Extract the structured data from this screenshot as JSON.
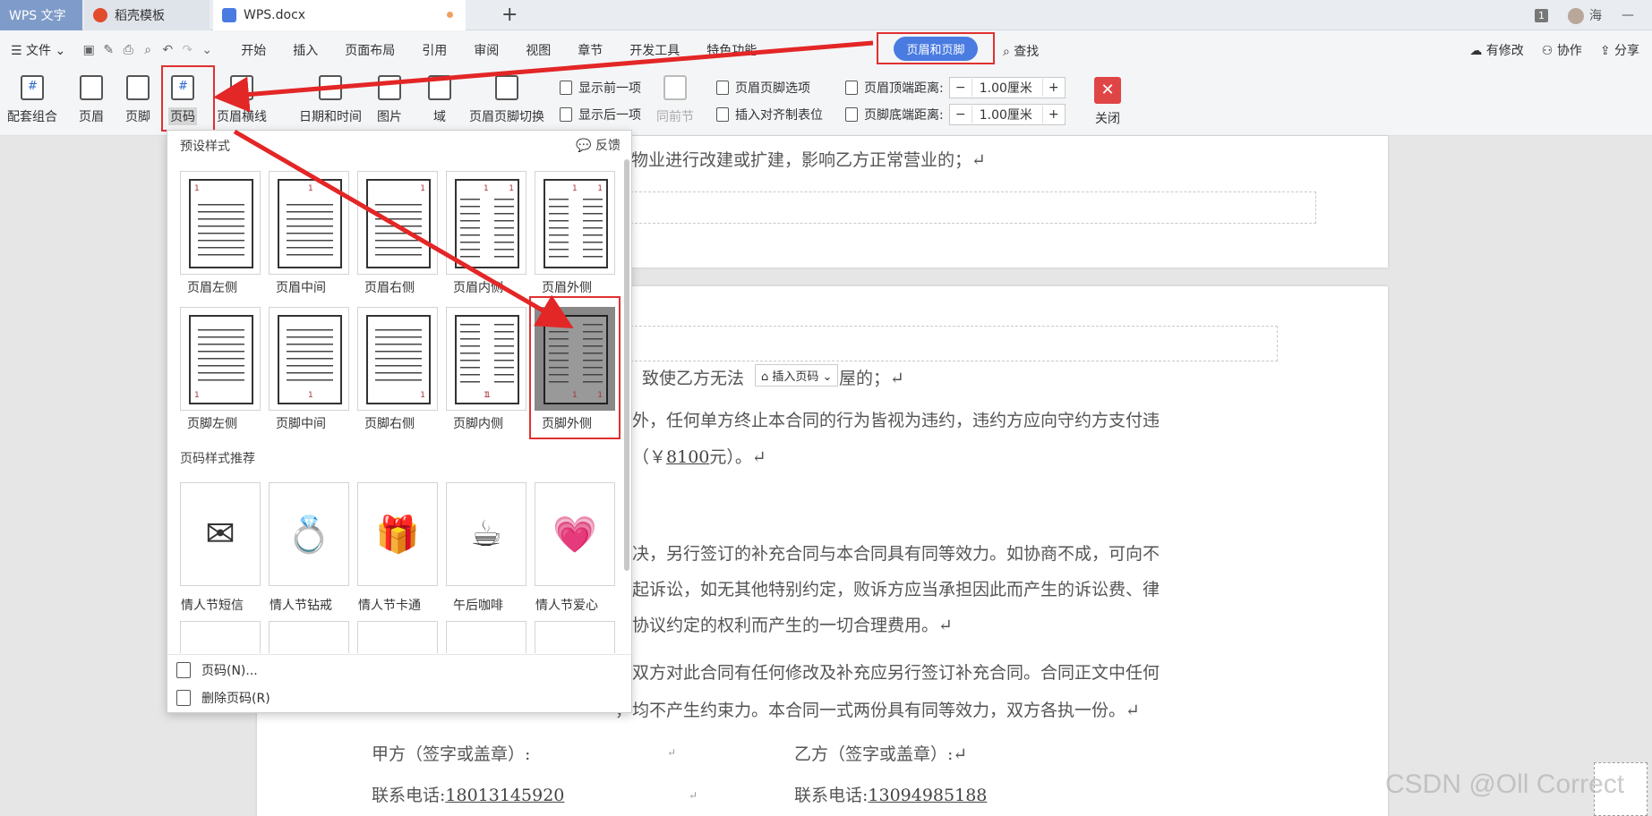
{
  "tabs": {
    "app": "WPS 文字",
    "daoke": "稻壳模板",
    "doc": "WPS.docx",
    "new": "+"
  },
  "window": {
    "count": "1",
    "user": "海",
    "min": "—"
  },
  "menu": {
    "file": "文件",
    "items": [
      "开始",
      "插入",
      "页面布局",
      "引用",
      "审阅",
      "视图",
      "章节",
      "开发工具",
      "特色功能"
    ],
    "active": "页眉和页脚",
    "search": "查找",
    "right": [
      "有修改",
      "协作",
      "分享"
    ]
  },
  "ribbon": {
    "combo": "配套组合",
    "header": "页眉",
    "footer": "页脚",
    "pagenum": "页码",
    "headerline": "页眉横线",
    "datetime": "日期和时间",
    "picture": "图片",
    "field": "域",
    "switch": "页眉页脚切换",
    "prev": "显示前一项",
    "next": "显示后一项",
    "same": "同前节",
    "options": "页眉页脚选项",
    "tabs": "插入对齐制表位",
    "top_label": "页眉顶端距离:",
    "top_val": "1.00厘米",
    "bottom_label": "页脚底端距离:",
    "bottom_val": "1.00厘米",
    "close": "关闭",
    "minus": "−",
    "plus": "+"
  },
  "panel": {
    "preset": "预设样式",
    "feedback": "反馈",
    "row1": [
      "页眉左侧",
      "页眉中间",
      "页眉右侧",
      "页眉内侧",
      "页眉外侧"
    ],
    "row2": [
      "页脚左侧",
      "页脚中间",
      "页脚右侧",
      "页脚内侧",
      "页脚外侧"
    ],
    "rec_title": "页码样式推荐",
    "rec": [
      "情人节短信",
      "情人节钻戒",
      "情人节卡通",
      "午后咖啡",
      "情人节爱心"
    ],
    "rec_icons": [
      "✉",
      "💍",
      "🎁",
      "☕",
      "💗"
    ],
    "action1": "页码(N)...",
    "action2": "删除页码(R)",
    "num": "1"
  },
  "doc": {
    "l1": "租赁物业进行改建或扩建，影响乙方正常营业的；↵",
    "l2a": "致使乙方无法",
    "insert_pn": "插入页码",
    "l2b": "屋的；↵",
    "l3": "款外，任何单方终止本合同的行为皆视为违约，违约方应向守约方支付违",
    "l4a": "整（￥",
    "l4amt": "8100",
    "l4b": "元）。↵",
    "l5": "解决，另行签订的补充合同与本合同具有同等效力。如协商不成，可向不",
    "l6": "提起诉讼，如无其他特别约定，败诉方应当承担因此而产生的诉讼费、律",
    "l7": "本协议约定的权利而产生的一切合理费用。↵",
    "l8": "如双方对此合同有任何修改及补充应另行签订补充合同。合同正文中任何",
    "l9": "，均不产生约束力。本合同一式两份具有同等效力，双方各执一份。↵",
    "partyA": "甲方（签字或盖章）:",
    "partyB": "乙方（签字或盖章）:↵",
    "phoneA_label": "联系电话:",
    "phoneA": "18013145920",
    "phoneB_label": "联系电话:",
    "phoneB": "13094985188",
    "arrow": "↵"
  },
  "watermark": "CSDN @Oll Correct"
}
